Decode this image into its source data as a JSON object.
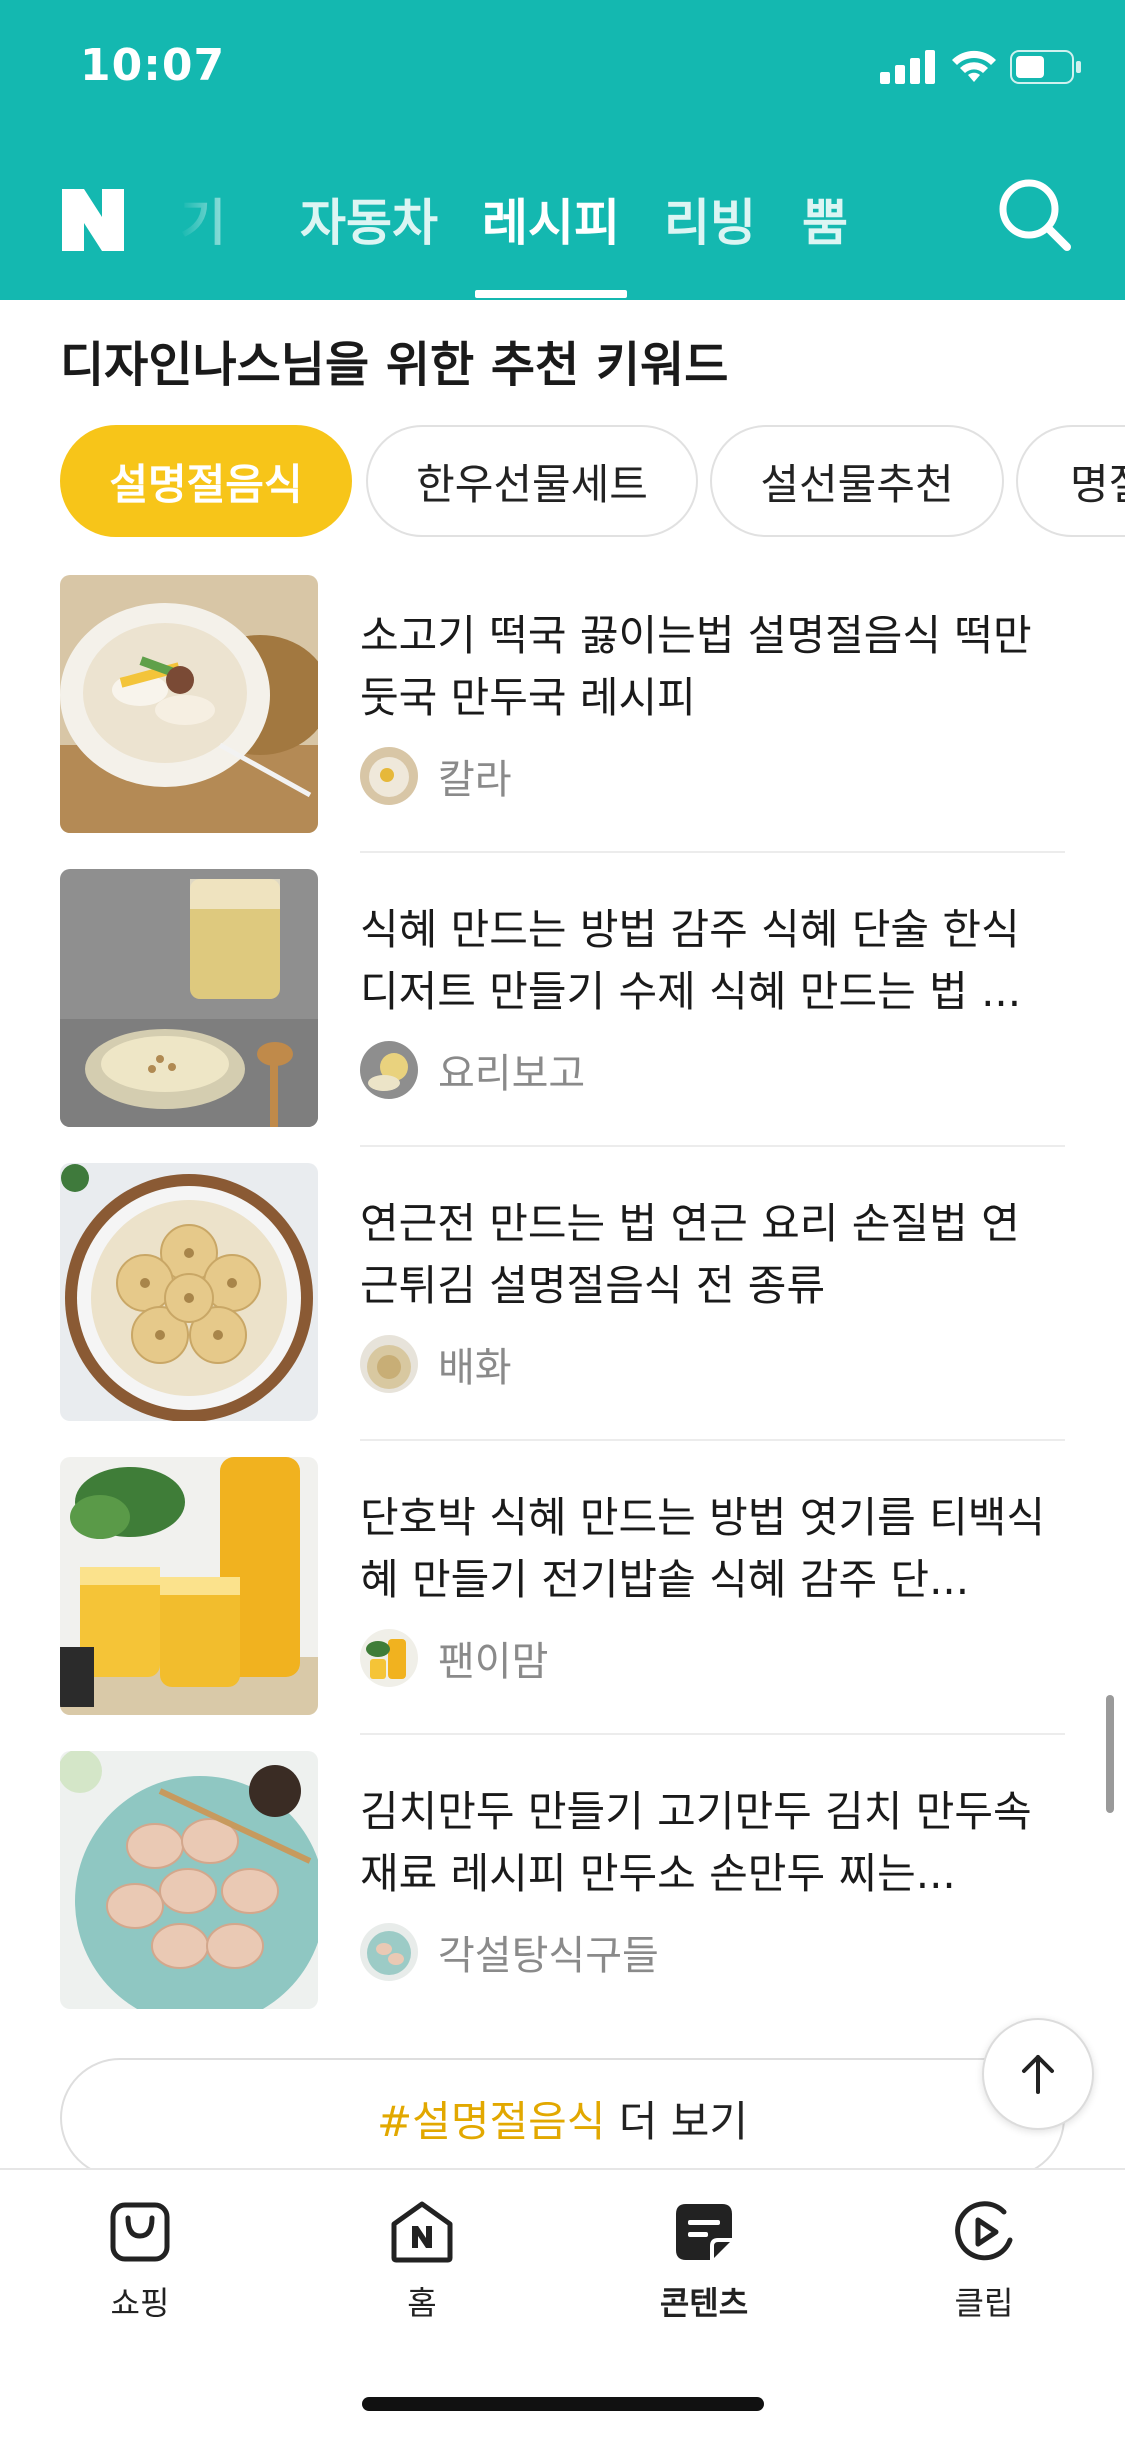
{
  "status_bar": {
    "time": "10:07"
  },
  "header": {
    "logo_text": "N",
    "tabs": [
      {
        "label": "기"
      },
      {
        "label": "자동차"
      },
      {
        "label": "레시피",
        "active": true
      },
      {
        "label": "리빙"
      },
      {
        "label": "뿜"
      }
    ],
    "brand_color": "#14b8b0",
    "search_icon": "search-icon"
  },
  "keywords": {
    "title": "디자인나스님을 위한 추천 키워드",
    "chips": [
      {
        "label": "설명절음식",
        "active": true
      },
      {
        "label": "한우선물세트"
      },
      {
        "label": "설선물추천"
      },
      {
        "label": "명절"
      }
    ],
    "accent_color": "#f7c519"
  },
  "articles": [
    {
      "title": "소고기 떡국 끓이는법 설명절음식 떡만둣국 만두국 레시피",
      "author": "칼라"
    },
    {
      "title": "식혜 만드는 방법 감주 식혜 단술 한식디저트 만들기 수제 식혜 만드는 법 ...",
      "author": "요리보고"
    },
    {
      "title": "연근전 만드는 법 연근 요리 손질법 연근튀김 설명절음식 전 종류",
      "author": "배화"
    },
    {
      "title": "단호박 식혜 만드는 방법 엿기름 티백식혜 만들기 전기밥솥 식혜 감주 단...",
      "author": "팬이맘"
    },
    {
      "title": "김치만두 만들기 고기만두 김치 만두속 재료 레시피 만두소 손만두 찌는...",
      "author": "각설탕식구들"
    }
  ],
  "more": {
    "tag": "#설명절음식",
    "suffix": " 더 보기"
  },
  "bottom_nav": [
    {
      "label": "쇼핑",
      "icon": "shopping-bag-icon"
    },
    {
      "label": "홈",
      "icon": "home-icon"
    },
    {
      "label": "콘텐츠",
      "icon": "contents-icon",
      "active": true
    },
    {
      "label": "클립",
      "icon": "clip-icon"
    }
  ]
}
